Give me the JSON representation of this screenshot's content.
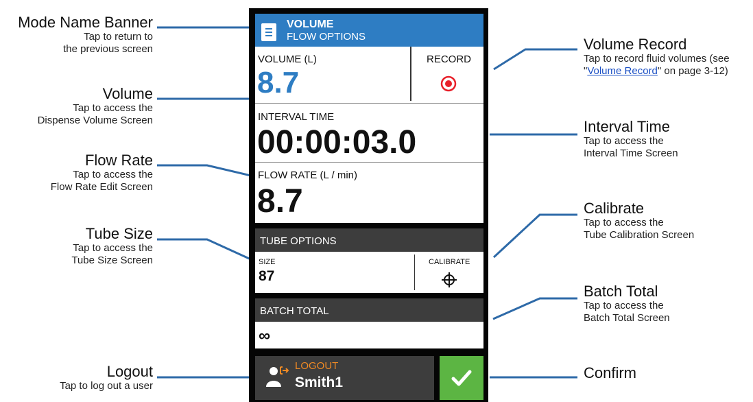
{
  "callouts": {
    "mode_banner": {
      "title": "Mode Name Banner",
      "desc": [
        "Tap to return to",
        "the previous screen"
      ]
    },
    "volume": {
      "title": "Volume",
      "desc": [
        "Tap to access the",
        "Dispense Volume Screen"
      ]
    },
    "flow_rate": {
      "title": "Flow Rate",
      "desc": [
        "Tap to access the",
        "Flow Rate Edit Screen"
      ]
    },
    "tube_size": {
      "title": "Tube Size",
      "desc": [
        "Tap to access the",
        "Tube Size Screen"
      ]
    },
    "logout": {
      "title": "Logout",
      "desc": [
        "Tap to log out a user"
      ]
    },
    "volume_record": {
      "title": "Volume Record",
      "desc_line1": "Tap to record fluid volumes (see",
      "desc_line2_prefix": "\"",
      "desc_link": "Volume Record",
      "desc_line2_suffix": "\" on page 3-12)"
    },
    "interval_time": {
      "title": "Interval Time",
      "desc": [
        "Tap to access the",
        "Interval Time Screen"
      ]
    },
    "calibrate": {
      "title": "Calibrate",
      "desc": [
        "Tap to access the",
        "Tube Calibration Screen"
      ]
    },
    "batch_total": {
      "title": "Batch Total",
      "desc": [
        "Tap to access the",
        "Batch Total Screen"
      ]
    },
    "confirm": {
      "title": "Confirm"
    }
  },
  "screen": {
    "banner": {
      "mode": "VOLUME",
      "sub": "FLOW OPTIONS"
    },
    "volume": {
      "label": "VOLUME (L)",
      "value": "8.7"
    },
    "record": {
      "label": "RECORD"
    },
    "interval": {
      "label": "INTERVAL TIME",
      "value": "00:00:03.0"
    },
    "flow_rate": {
      "label": "FLOW RATE (L / min)",
      "value": "8.7"
    },
    "tube_options": {
      "header": "TUBE OPTIONS",
      "size_label": "SIZE",
      "size_value": "87",
      "calibrate_label": "CALIBRATE"
    },
    "batch_total": {
      "header": "BATCH TOTAL",
      "value": "∞"
    },
    "logout": {
      "label": "LOGOUT",
      "user": "Smith1"
    }
  },
  "colors": {
    "banner": "#2e7dc3",
    "accent_blue": "#2e7dc3",
    "record_red": "#e8202a",
    "confirm_green": "#5cb543",
    "logout_orange": "#f08a24",
    "header_gray": "#3d3d3d"
  },
  "icons": [
    "list-icon",
    "record-icon",
    "crosshair-icon",
    "user-logout-icon",
    "checkmark-icon"
  ]
}
